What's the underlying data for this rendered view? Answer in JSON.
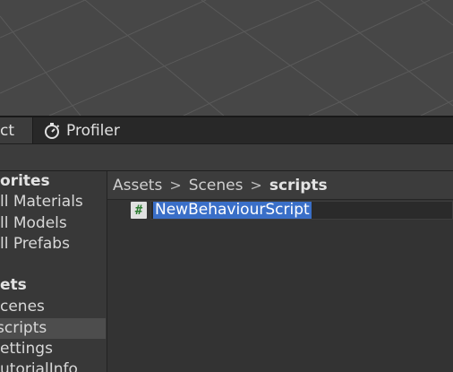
{
  "tabs": {
    "project_label": "ct",
    "profiler_label": "Profiler"
  },
  "tree": {
    "favorites_header": "orites",
    "all_materials": "ll Materials",
    "all_models": "ll Models",
    "all_prefabs": "ll Prefabs",
    "assets_header": "ets",
    "scenes": "cenes",
    "scripts": "scripts",
    "settings": "ettings",
    "tutorial_info": "utorialInfo"
  },
  "breadcrumb": {
    "assets": "Assets",
    "scenes": "Scenes",
    "scripts": "scripts",
    "separator": ">"
  },
  "file": {
    "icon_glyph": "#",
    "rename_value": "NewBehaviourScript"
  },
  "colors": {
    "selection": "#3a6fc8",
    "script_icon_hash": "#2e7d32",
    "scene_background": "#474747"
  }
}
